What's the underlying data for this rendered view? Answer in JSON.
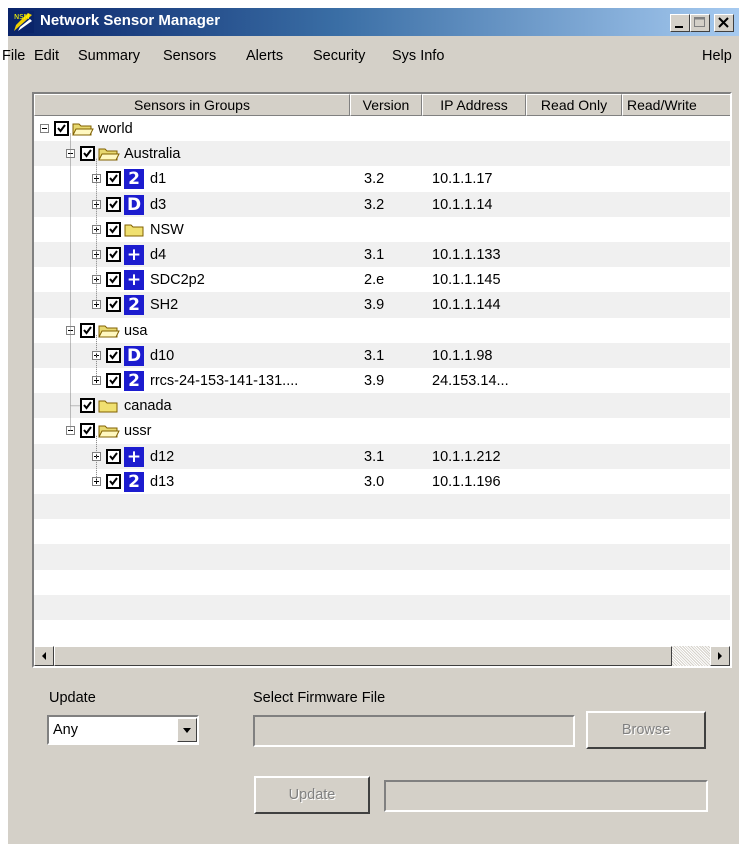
{
  "window": {
    "title": "Network Sensor Manager",
    "app_icon_text": "NSM"
  },
  "menu": [
    {
      "label": "File"
    },
    {
      "label": "Edit"
    },
    {
      "label": "Summary"
    },
    {
      "label": "Sensors"
    },
    {
      "label": "Alerts"
    },
    {
      "label": "Security"
    },
    {
      "label": "Sys Info"
    },
    {
      "label": "Help"
    }
  ],
  "list": {
    "columns": [
      "Sensors in Groups",
      "Version",
      "IP Address",
      "Read Only",
      "Read/Write"
    ],
    "rows": [
      {
        "label": "world",
        "type": "folder",
        "version": "",
        "ip": ""
      },
      {
        "label": "Australia",
        "type": "folder",
        "version": "",
        "ip": ""
      },
      {
        "label": "d1",
        "type": "sensor",
        "icon": "2",
        "version": "3.2",
        "ip": "10.1.1.17"
      },
      {
        "label": "d3",
        "type": "sensor",
        "icon": "D",
        "version": "3.2",
        "ip": "10.1.1.14"
      },
      {
        "label": "NSW",
        "type": "folder",
        "version": "",
        "ip": ""
      },
      {
        "label": "d4",
        "type": "sensor",
        "icon": "+",
        "version": "3.1",
        "ip": "10.1.1.133"
      },
      {
        "label": "SDC2p2",
        "type": "sensor",
        "icon": "+",
        "version": "2.e",
        "ip": "10.1.1.145"
      },
      {
        "label": "SH2",
        "type": "sensor",
        "icon": "2",
        "version": "3.9",
        "ip": "10.1.1.144"
      },
      {
        "label": "usa",
        "type": "folder",
        "version": "",
        "ip": ""
      },
      {
        "label": "d10",
        "type": "sensor",
        "icon": "D",
        "version": "3.1",
        "ip": "10.1.1.98"
      },
      {
        "label": "rrcs-24-153-141-131....",
        "type": "sensor",
        "icon": "2",
        "version": "3.9",
        "ip": "24.153.14..."
      },
      {
        "label": "canada",
        "type": "folder",
        "version": "",
        "ip": ""
      },
      {
        "label": "ussr",
        "type": "folder",
        "version": "",
        "ip": ""
      },
      {
        "label": "d12",
        "type": "sensor",
        "icon": "+",
        "version": "3.1",
        "ip": "10.1.1.212"
      },
      {
        "label": "d13",
        "type": "sensor",
        "icon": "2",
        "version": "3.0",
        "ip": "10.1.1.196"
      }
    ]
  },
  "update": {
    "label": "Update",
    "selected": "Any"
  },
  "firmware": {
    "label": "Select Firmware File",
    "value": "",
    "browse_label": "Browse",
    "update_button_label": "Update",
    "status_value": ""
  },
  "colors": {
    "titlebar_start": "#0a246a",
    "titlebar_end": "#a6caf0",
    "face": "#d4d0c8",
    "sensor_icon": "#1c1ccf"
  }
}
